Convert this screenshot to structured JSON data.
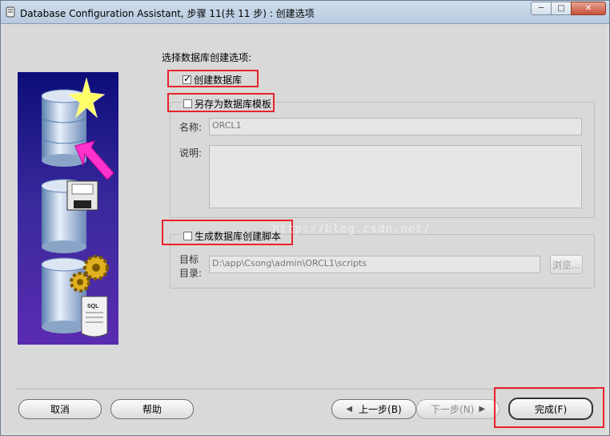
{
  "window": {
    "title": "Database Configuration Assistant, 步骤 11(共 11 步) : 创建选项",
    "minimize_glyph": "─",
    "maximize_glyph": "□",
    "close_glyph": "✕"
  },
  "prompt": "选择数据库创建选项:",
  "options": {
    "create_database": {
      "label": "创建数据库",
      "checked": true
    },
    "save_template": {
      "label": "另存为数据库模板",
      "checked": false
    },
    "generate_scripts": {
      "label": "生成数据库创建脚本",
      "checked": false
    }
  },
  "template_group": {
    "name_label": "名称:",
    "name_value": "ORCL1",
    "description_label": "说明:",
    "description_value": ""
  },
  "scripts_group": {
    "target_label_line1": "目标",
    "target_label_line2": "目录:",
    "target_value": "D:\\app\\Csong\\admin\\ORCL1\\scripts",
    "browse_label": "浏览..."
  },
  "buttons": {
    "cancel": "取消",
    "help": "帮助",
    "back": "上一步(B)",
    "next": "下一步(N)",
    "finish": "完成(F)"
  },
  "watermark": "http://blog.csdn.net/",
  "colors": {
    "highlight": "#e8232b",
    "illustration_bg": "#22228a",
    "arrow": "#ff33cc",
    "star": "#ffff66"
  },
  "icons": [
    "database-icon",
    "star-icon",
    "arrow-icon",
    "floppy-disk-icon",
    "gear-icon",
    "sql-script-icon"
  ]
}
